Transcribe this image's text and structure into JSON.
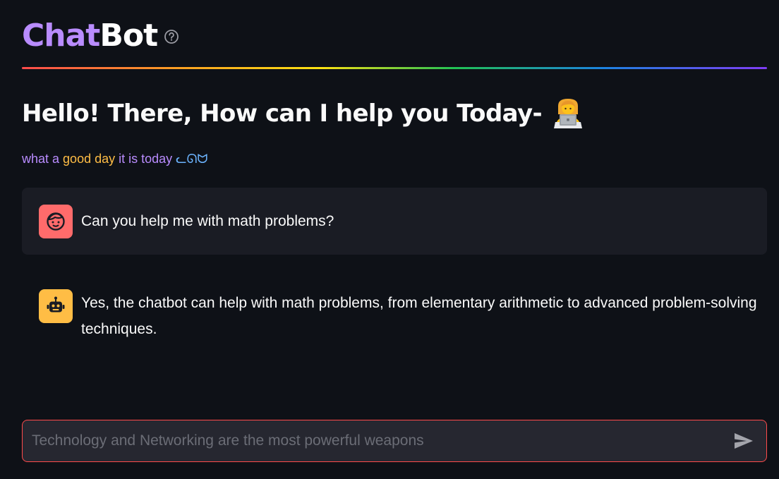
{
  "header": {
    "title_part1": "Chat",
    "title_part2": "Bot",
    "help_icon": "question-circle-icon",
    "accent_color": "#b98cff"
  },
  "greeting": {
    "text": "Hello! There, How can I help you Today-",
    "emoji": "woman-technologist-emoji"
  },
  "subtitle": {
    "part1": "what a ",
    "part2": "good day",
    "part3": " it is today ",
    "part4": "ᓚᘏᗢ"
  },
  "messages": [
    {
      "role": "user",
      "avatar": "user-face-icon",
      "text": "Can you help me with math problems?",
      "avatar_color": "#ff6b6b"
    },
    {
      "role": "assistant",
      "avatar": "robot-icon",
      "text": "Yes, the chatbot can help with math problems, from elementary arithmetic to advanced problem-solving techniques.",
      "avatar_color": "#ffbd45"
    }
  ],
  "chat_input": {
    "placeholder": "Technology and Networking are the most powerful weapons",
    "value": "",
    "send_icon": "send-arrow-icon"
  }
}
